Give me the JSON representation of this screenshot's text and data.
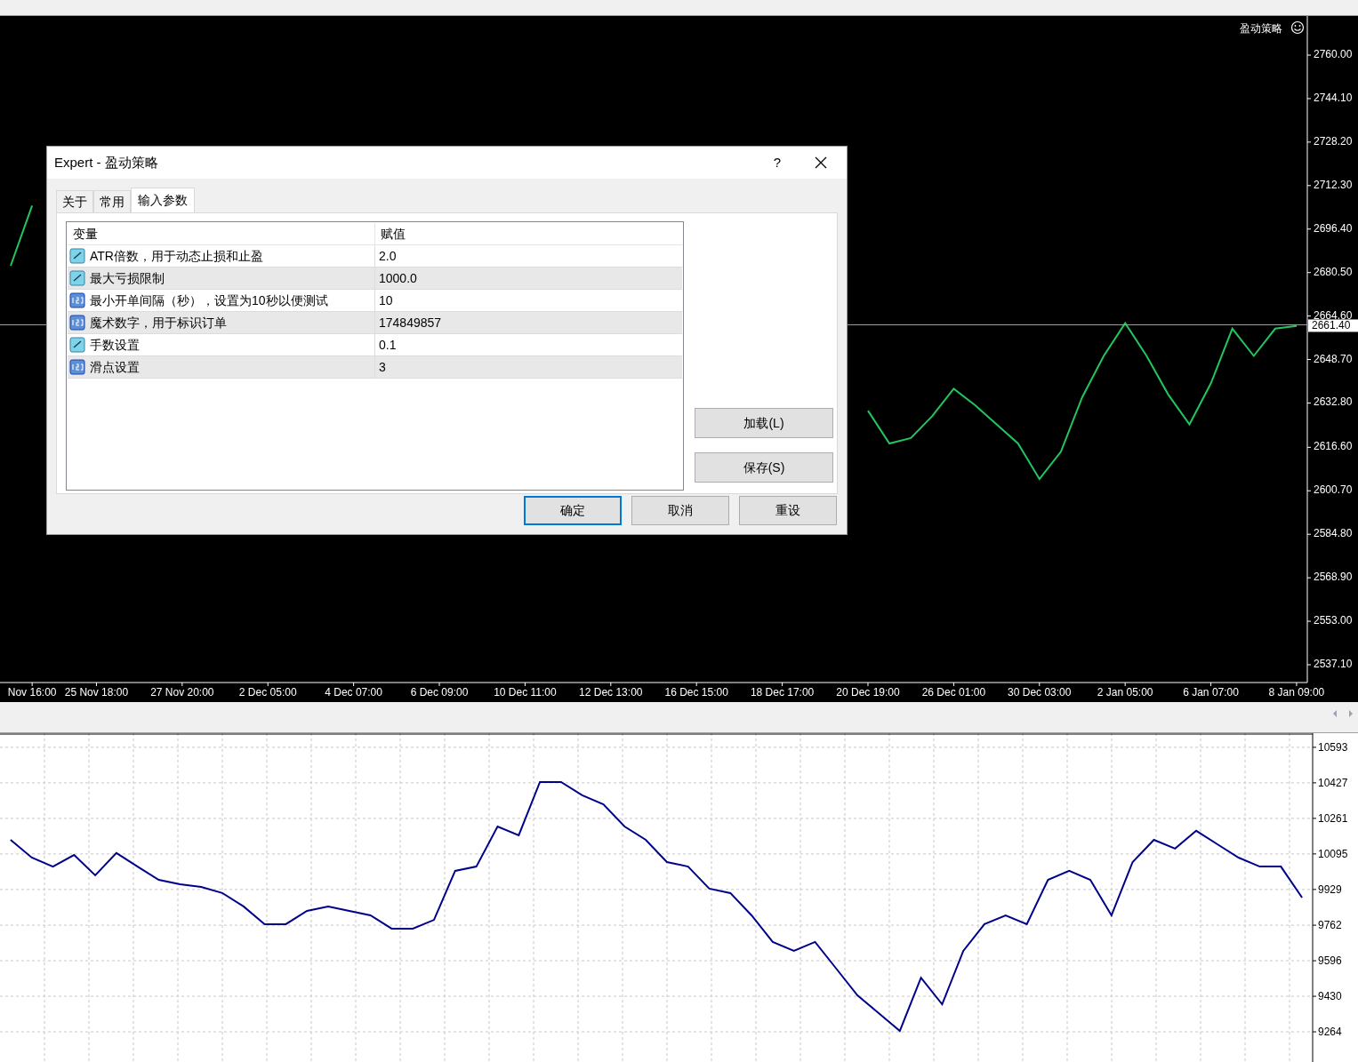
{
  "main_chart": {
    "expert_label": "盈动策略",
    "chart_data": {
      "type": "line",
      "categories": [
        null,
        "Nov 16:00",
        null,
        null,
        "25 Nov 18:00",
        null,
        null,
        null,
        "27 Nov 20:00",
        null,
        null,
        null,
        "2 Dec 05:00",
        null,
        null,
        null,
        "4 Dec 07:00",
        null,
        null,
        null,
        "6 Dec 09:00",
        null,
        null,
        null,
        "10 Dec 11:00",
        null,
        null,
        null,
        "12 Dec 13:00",
        null,
        null,
        null,
        "16 Dec 15:00",
        null,
        null,
        null,
        "18 Dec 17:00",
        null,
        null,
        null,
        "20 Dec 19:00",
        null,
        null,
        null,
        "26 Dec 01:00",
        null,
        null,
        null,
        "30 Dec 03:00",
        null,
        null,
        null,
        "2 Jan 05:00",
        null,
        null,
        null,
        "6 Jan 07:00",
        null,
        null,
        null,
        "8 Jan 09:00"
      ],
      "series": [
        {
          "color": "#22c55e",
          "values": [
            2683,
            2705,
            null,
            null,
            null,
            null,
            null,
            null,
            null,
            null,
            null,
            null,
            null,
            null,
            null,
            null,
            null,
            null,
            null,
            null,
            null,
            null,
            null,
            null,
            null,
            null,
            null,
            null,
            null,
            null,
            null,
            null,
            null,
            null,
            null,
            null,
            null,
            null,
            null,
            null,
            2630,
            2618,
            2620,
            2628,
            2638,
            2632,
            2625,
            2618,
            2605,
            2615,
            2635,
            2650,
            2662,
            2650,
            2636,
            2625,
            2640,
            2660,
            2650,
            2660,
            2661
          ]
        }
      ],
      "ylim": [
        2530.6,
        2774.3
      ],
      "yticks": [
        {
          "value": 2760,
          "label": "2760.00"
        },
        {
          "value": 2744.1,
          "label": "2744.10"
        },
        {
          "value": 2728.2,
          "label": "2728.20"
        },
        {
          "value": 2712.3,
          "label": "2712.30"
        },
        {
          "value": 2696.4,
          "label": "2696.40"
        },
        {
          "value": 2680.5,
          "label": "2680.50"
        },
        {
          "value": 2664.6,
          "label": "2664.60"
        },
        {
          "value": 2648.7,
          "label": "2648.70"
        },
        {
          "value": 2632.8,
          "label": "2632.80"
        },
        {
          "value": 2616.6,
          "label": "2616.60"
        },
        {
          "value": 2600.7,
          "label": "2600.70"
        },
        {
          "value": 2584.8,
          "label": "2584.80"
        },
        {
          "value": 2568.9,
          "label": "2568.90"
        },
        {
          "value": 2553,
          "label": "2553.00"
        },
        {
          "value": 2537.1,
          "label": "2537.10"
        }
      ],
      "ref_lines": [
        {
          "axis": "y",
          "value": 2661.4,
          "label": "2661.40",
          "color": "#9ca3af"
        }
      ]
    }
  },
  "equity_chart": {
    "chart_data": {
      "type": "line",
      "grid": true,
      "categories": [
        null,
        null,
        null,
        null,
        null,
        null,
        null,
        null,
        null,
        null,
        null,
        null,
        null,
        null,
        null,
        null,
        null,
        null,
        null,
        null,
        null,
        null,
        null,
        null,
        null,
        null,
        null,
        null,
        null,
        null,
        null,
        null,
        null,
        null,
        null,
        null,
        null,
        null,
        null,
        null,
        null,
        null,
        null,
        null,
        null,
        null,
        null,
        null,
        null,
        null,
        null,
        null,
        null,
        null,
        null,
        null,
        null,
        null,
        null,
        null,
        null,
        null
      ],
      "series": [
        {
          "color": "#00008b",
          "values": [
            10161,
            10078,
            10036,
            10090,
            9995,
            10099,
            10036,
            9974,
            9953,
            9941,
            9912,
            9850,
            9767,
            9767,
            9829,
            9850,
            9829,
            9808,
            9746,
            9746,
            9787,
            10016,
            10036,
            10223,
            10182,
            10431,
            10431,
            10369,
            10327,
            10223,
            10161,
            10057,
            10036,
            9933,
            9912,
            9808,
            9684,
            9642,
            9684,
            9559,
            9434,
            9351,
            9268,
            9517,
            9393,
            9642,
            9767,
            9808,
            9767,
            9974,
            10016,
            9974,
            9808,
            10057,
            10161,
            10120,
            10203,
            10140,
            10078,
            10036,
            10036,
            9891
          ]
        }
      ],
      "ylim": [
        9123,
        10659
      ],
      "yticks": [
        {
          "value": 10593,
          "label": "10593"
        },
        {
          "value": 10427,
          "label": "10427"
        },
        {
          "value": 10261,
          "label": "10261"
        },
        {
          "value": 10095,
          "label": "10095"
        },
        {
          "value": 9929,
          "label": "9929"
        },
        {
          "value": 9762,
          "label": "9762"
        },
        {
          "value": 9596,
          "label": "9596"
        },
        {
          "value": 9430,
          "label": "9430"
        },
        {
          "value": 9264,
          "label": "9264"
        }
      ]
    }
  },
  "dialog": {
    "title": "Expert - 盈动策略",
    "help": "?",
    "tabs": [
      {
        "label": "关于",
        "selected": false
      },
      {
        "label": "常用",
        "selected": false
      },
      {
        "label": "输入参数",
        "selected": true
      }
    ],
    "table": {
      "columns": [
        "变量",
        "赋值"
      ],
      "rows": [
        {
          "kind": "double",
          "name": "ATR倍数，用于动态止损和止盈",
          "value": "2.0"
        },
        {
          "kind": "double",
          "name": "最大亏损限制",
          "value": "1000.0"
        },
        {
          "kind": "integer",
          "name": "最小开单间隔（秒），设置为10秒以便测试",
          "value": "10"
        },
        {
          "kind": "integer",
          "name": "魔术数字，用于标识订单",
          "value": "174849857"
        },
        {
          "kind": "double",
          "name": "手数设置",
          "value": "0.1"
        },
        {
          "kind": "integer",
          "name": "滑点设置",
          "value": "3"
        }
      ]
    },
    "side_buttons": [
      "加载(L)",
      "保存(S)"
    ],
    "buttons": [
      {
        "label": "确定",
        "default": true
      },
      {
        "label": "取消",
        "default": false
      },
      {
        "label": "重设",
        "default": false
      }
    ]
  }
}
